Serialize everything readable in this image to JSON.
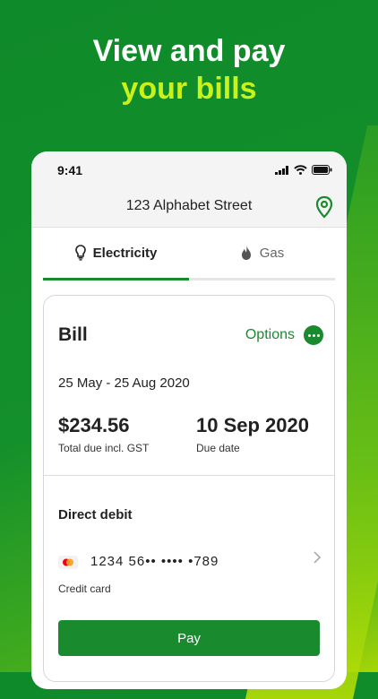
{
  "headline": {
    "line1": "View and pay",
    "line2": "your bills"
  },
  "status_bar": {
    "time": "9:41"
  },
  "address": "123 Alphabet Street",
  "tabs": [
    {
      "label": "Electricity",
      "active": true
    },
    {
      "label": "Gas",
      "active": false
    }
  ],
  "bill": {
    "title": "Bill",
    "options_label": "Options",
    "period": "25 May - 25 Aug 2020",
    "amount": "$234.56",
    "amount_label": "Total due incl. GST",
    "due_date": "10 Sep 2020",
    "due_label": "Due date"
  },
  "payment": {
    "title": "Direct debit",
    "card_number": "1234  56••  ••••  •789",
    "card_type": "Credit card",
    "pay_label": "Pay"
  },
  "colors": {
    "brand_green": "#1a8a2e",
    "accent_lime": "#c8f21a"
  }
}
